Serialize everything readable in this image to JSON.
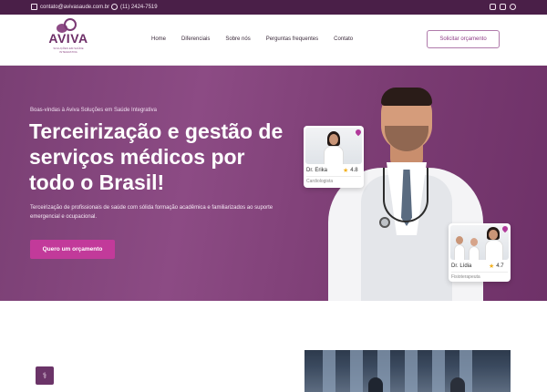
{
  "topbar": {
    "email": "contato@avivasaude.com.br",
    "phone": "(11) 2424-7519",
    "social_icons": [
      "facebook-icon",
      "instagram-icon",
      "whatsapp-icon"
    ]
  },
  "header": {
    "logo_text": "AVIVA",
    "logo_tagline": "SOLUÇÕES EM SAÚDE INTEGRATIVA",
    "nav": [
      "Home",
      "Diferenciais",
      "Sobre nós",
      "Perguntas frequentes",
      "Contato"
    ],
    "cta_label": "Solicitar orçamento"
  },
  "hero": {
    "welcome": "Boas-vindas à Aviva Soluções em Saúde Integrativa",
    "title": "Terceirização e gestão de serviços médicos por todo o Brasil!",
    "description": "Terceirização de profissionais de saúde com sólida formação acadêmica e familiarizados ao suporte emergencial e ocupacional.",
    "cta_label": "Quero um orçamento"
  },
  "cards": [
    {
      "name": "Dr. Erika",
      "rating": "4.8",
      "specialty": "Cardiologista"
    },
    {
      "name": "Dr. Lídia",
      "rating": "4.7",
      "specialty": "Fisioterapeuta"
    }
  ],
  "colors": {
    "topbar": "#4a1f48",
    "brand": "#6e2f68",
    "hero_bg": "#7a3f74",
    "cta": "#c23a9a",
    "star": "#f2b01e"
  }
}
